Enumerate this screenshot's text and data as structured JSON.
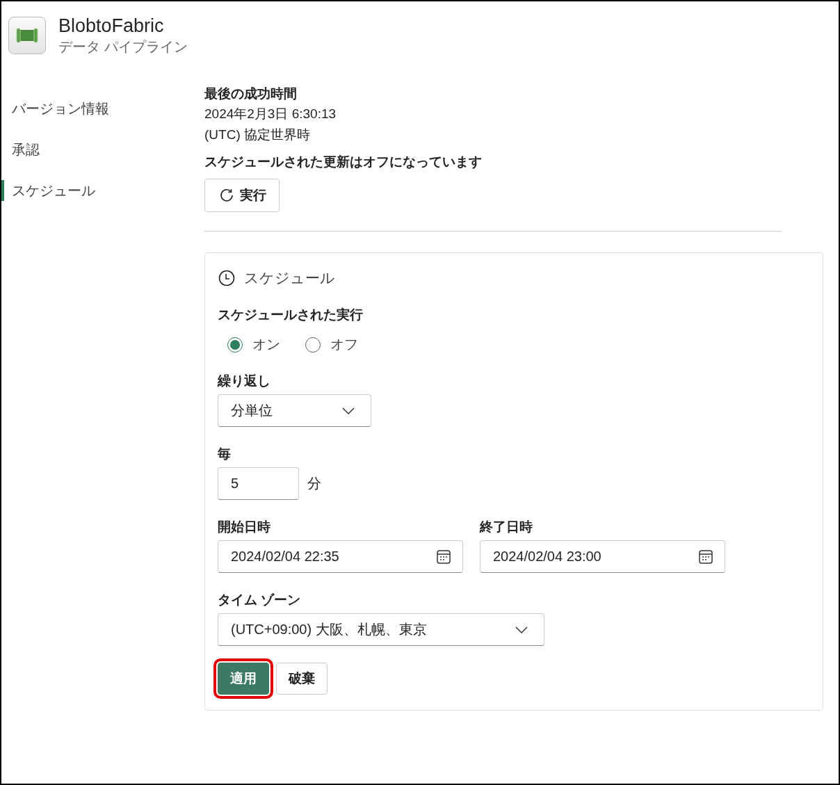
{
  "header": {
    "title": "BlobtoFabric",
    "subtitle": "データ パイプライン"
  },
  "sidebar": {
    "items": [
      {
        "label": "バージョン情報",
        "selected": false
      },
      {
        "label": "承認",
        "selected": false
      },
      {
        "label": "スケジュール",
        "selected": true
      }
    ]
  },
  "status": {
    "heading": "最後の成功時間",
    "time": "2024年2月3日 6:30:13",
    "timezone": "(UTC) 協定世界時",
    "notice": "スケジュールされた更新はオフになっています",
    "run_button": "実行"
  },
  "schedule": {
    "title": "スケジュール",
    "run_label": "スケジュールされた実行",
    "run_options": [
      {
        "label": "オン",
        "selected": true
      },
      {
        "label": "オフ",
        "selected": false
      }
    ],
    "repeat_label": "繰り返し",
    "repeat_value": "分単位",
    "every_label": "毎",
    "every_value": "5",
    "every_unit": "分",
    "start_label": "開始日時",
    "start_value": "2024/02/04  22:35",
    "end_label": "終了日時",
    "end_value": "2024/02/04  23:00",
    "timezone_label": "タイム ゾーン",
    "timezone_value": "(UTC+09:00) 大阪、札幌、東京",
    "buttons": [
      {
        "label": "適用",
        "kind": "primary",
        "highlighted": true
      },
      {
        "label": "破棄",
        "kind": "secondary",
        "highlighted": false
      }
    ]
  }
}
